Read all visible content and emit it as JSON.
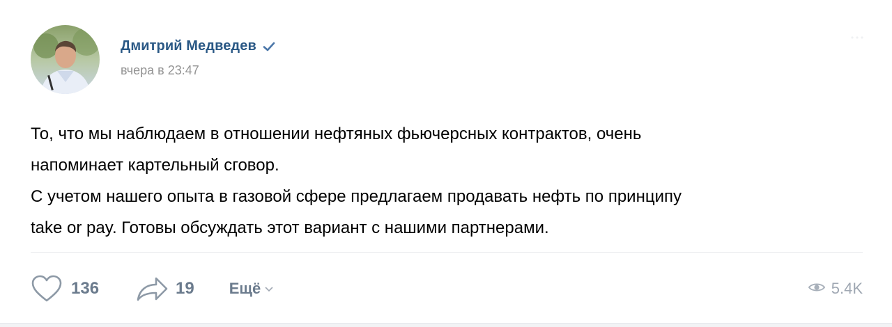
{
  "post": {
    "author": {
      "name": "Дмитрий Медведев",
      "verified": true
    },
    "timestamp": "вчера в 23:47",
    "text": {
      "line1": "То, что мы наблюдаем в отношении нефтяных фьючерсных контрактов, очень",
      "line2": "напоминает картельный сговор.",
      "line3": "С учетом нашего опыта в газовой сфере предлагаем продавать нефть по принципу",
      "line4": "take or pay. Готовы обсуждать этот вариант с нашими партнерами."
    },
    "actions": {
      "likes": "136",
      "shares": "19",
      "more_label": "Ещё"
    },
    "views": "5.4K"
  },
  "colors": {
    "link_blue": "#2a5885",
    "muted_gray": "#939393",
    "action_gray": "#6b7b8d",
    "verified_blue": "#4a76a8"
  },
  "icons": [
    "heart-icon",
    "share-arrow-icon",
    "chevron-down-icon",
    "eye-icon",
    "verified-check-icon",
    "more-menu-icon"
  ]
}
